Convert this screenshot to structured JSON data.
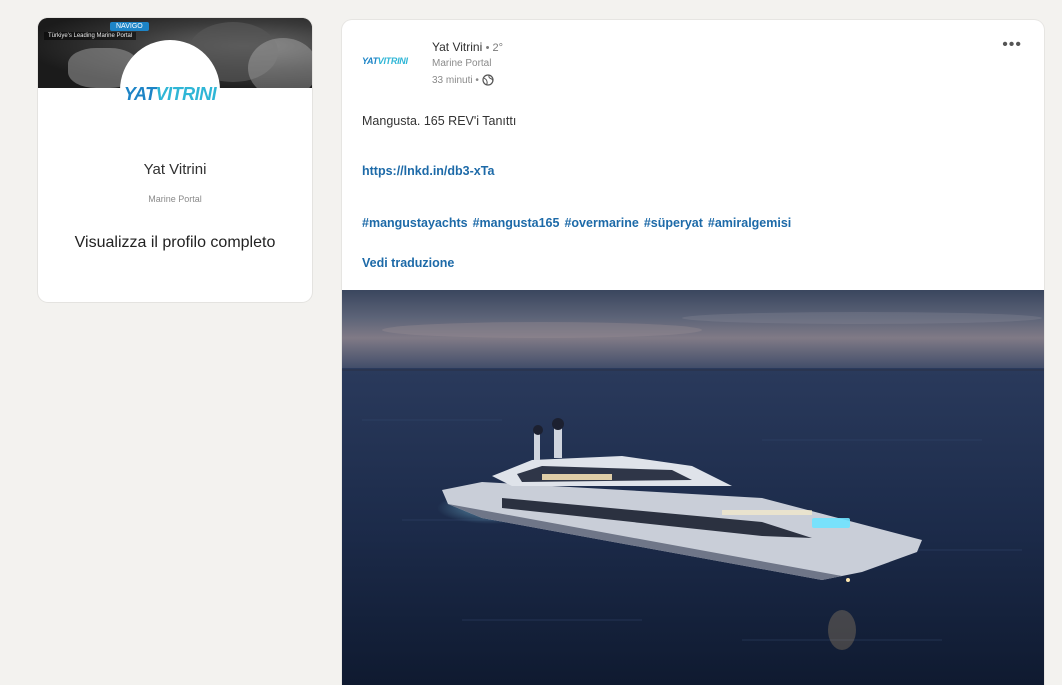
{
  "profile_card": {
    "cover_badge": "NAVIGO",
    "cover_tag": "Türkiye's Leading Marine Portal",
    "logo_part1": "YAT",
    "logo_part2": "VITRINI",
    "name": "Yat Vitrini",
    "subtitle": "Marine Portal",
    "link_label": "Visualizza il profilo completo"
  },
  "post": {
    "author": {
      "logo_part1": "YAT",
      "logo_part2": "VITRINI",
      "name": "Yat Vitrini",
      "degree": "• 2°",
      "subtitle": "Marine Portal",
      "time": "33 minuti •"
    },
    "more_label": "•••",
    "text": "Mangusta. 165 REV'i Tanıttı",
    "link": "https://lnkd.in/db3-xTa",
    "hashtags": [
      "#mangustayachts",
      "#mangusta165",
      "#overmarine",
      "#süperyat",
      "#amiralgemisi"
    ],
    "translate_label": "Vedi traduzione",
    "image_alt": "luxury-yacht-at-dusk-image"
  },
  "icons": {
    "globe": "globe-icon",
    "more": "more-options-icon"
  },
  "colors": {
    "page_bg": "#f3f2ef",
    "card_bg": "#ffffff",
    "link_blue": "#1d6aa8",
    "brand_blue": "#1d84c6",
    "brand_teal": "#2fb6d6"
  }
}
